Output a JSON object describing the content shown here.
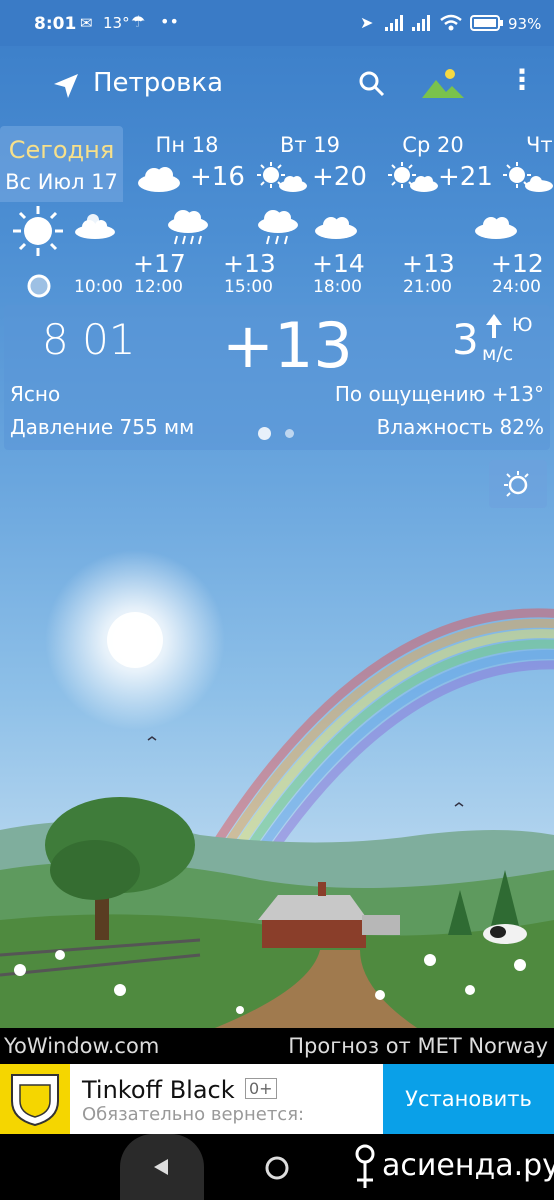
{
  "status": {
    "time": "8:01",
    "temp_badge": "13°",
    "battery": "93"
  },
  "appbar": {
    "location": "Петровка"
  },
  "forecast": [
    {
      "label": "Сегодня",
      "date": "Вс Июл 17",
      "temp": ""
    },
    {
      "label": "Пн 18",
      "temp": "+16"
    },
    {
      "label": "Вт 19",
      "temp": "+20"
    },
    {
      "label": "Ср 20",
      "temp": "+21"
    },
    {
      "label": "Чт",
      "temp": ""
    }
  ],
  "hourly": {
    "times": [
      "10:00",
      "12:00",
      "15:00",
      "18:00",
      "21:00",
      "24:00"
    ],
    "temps": [
      "+17",
      "+13",
      "+14",
      "+13",
      "+12"
    ]
  },
  "current": {
    "time": "8 01",
    "temp": "+13",
    "wind_speed": "3",
    "wind_unit": "м/с",
    "wind_dir": "Ю",
    "condition": "Ясно",
    "feels_like": "По ощущению +13°",
    "pressure": "Давление 755 мм",
    "humidity": "Влажность 82%"
  },
  "footer": {
    "site": "YoWindow.com",
    "source": "Прогноз от MET Norway"
  },
  "ad": {
    "title": "Tinkoff Black",
    "age": "0+",
    "subtitle": "Обязательно вернется:",
    "cta": "Установить"
  },
  "watermark": "асиенда.ру"
}
